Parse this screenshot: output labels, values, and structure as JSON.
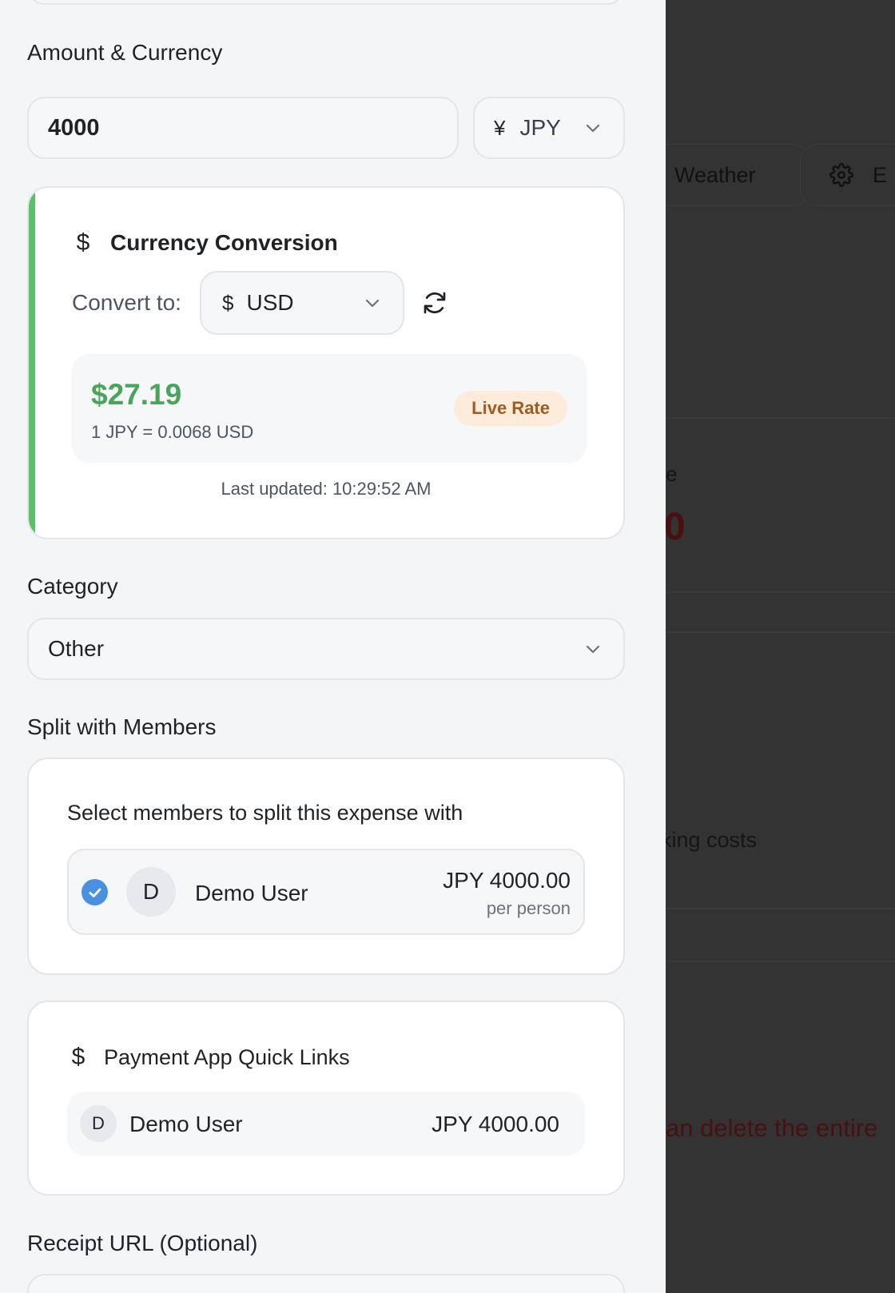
{
  "background": {
    "weather_chip": "Weather",
    "settings_chip": "E",
    "partial_label": "e",
    "partial_amount": "0",
    "partial_costs": "king costs",
    "partial_delete": "an delete the entire"
  },
  "form": {
    "amount_label": "Amount & Currency",
    "amount_value": "4000",
    "currency": {
      "symbol": "¥",
      "code": "JPY"
    },
    "conversion": {
      "title": "Currency Conversion",
      "icon": "dollar-icon",
      "convert_to_label": "Convert to:",
      "target": {
        "symbol": "$",
        "code": "USD"
      },
      "converted_amount": "$27.19",
      "rate_text": "1 JPY = 0.0068 USD",
      "badge": "Live Rate",
      "last_updated": "Last updated: 10:29:52 AM"
    },
    "category_label": "Category",
    "category_value": "Other",
    "split": {
      "label": "Split with Members",
      "hint": "Select members to split this expense with",
      "members": [
        {
          "initial": "D",
          "name": "Demo User",
          "amount": "JPY 4000.00",
          "per": "per person",
          "checked": true
        }
      ]
    },
    "payment": {
      "title": "Payment App Quick Links",
      "rows": [
        {
          "initial": "D",
          "name": "Demo User",
          "amount": "JPY 4000.00"
        }
      ]
    },
    "receipt_label": "Receipt URL (Optional)"
  },
  "colors": {
    "accent_green": "#5cbf6a",
    "amount_green": "#4aa55a",
    "checkbox_blue": "#4a90e2",
    "badge_bg": "#fdebdc",
    "badge_text": "#a15b21",
    "overlay": "#333333"
  }
}
